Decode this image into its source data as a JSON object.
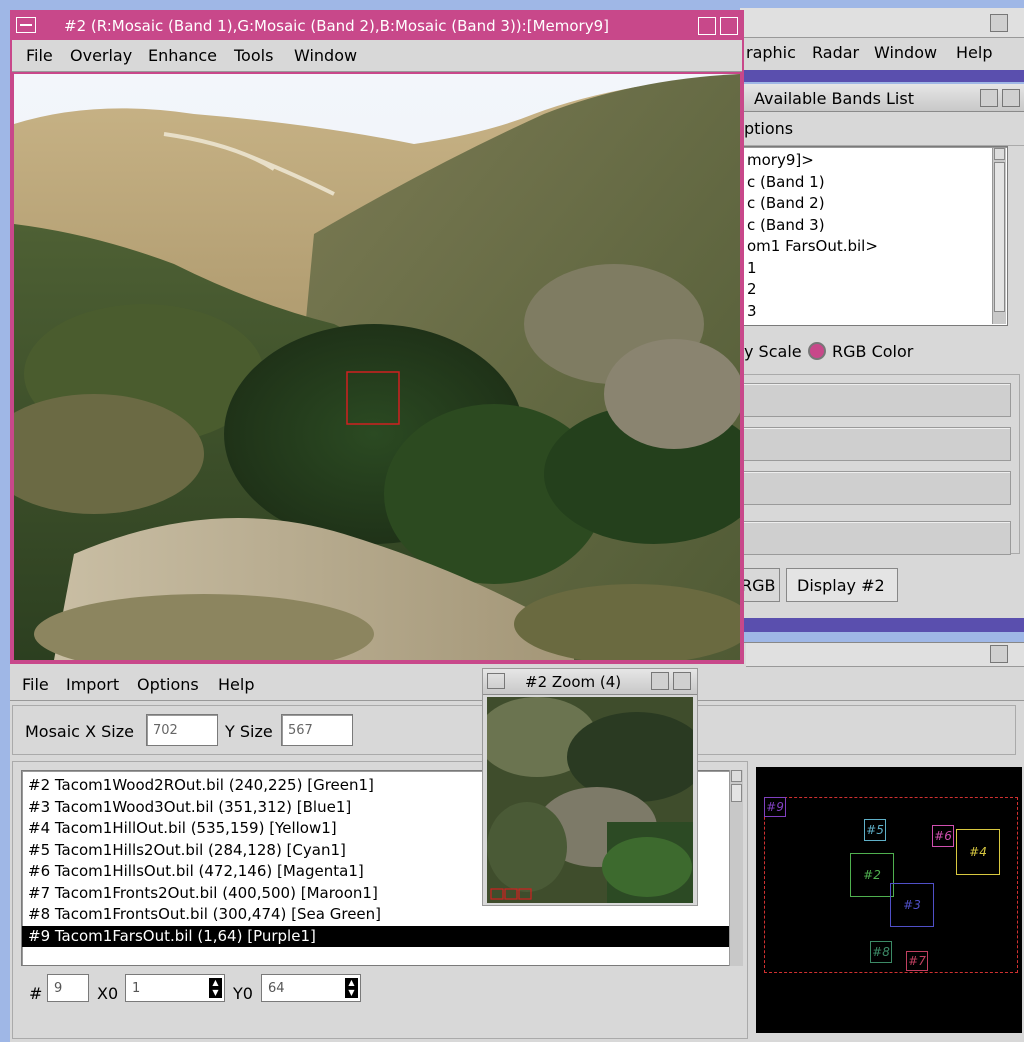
{
  "viewer": {
    "title": "#2 (R:Mosaic (Band 1),G:Mosaic (Band 2),B:Mosaic (Band 3)):[Memory9]",
    "menu": [
      "File",
      "Overlay",
      "Enhance",
      "Tools",
      "Window"
    ]
  },
  "main_menu": [
    "raphic",
    "Radar",
    "Window",
    "Help"
  ],
  "bands": {
    "title": "Available Bands List",
    "menu": "ptions",
    "items": [
      "mory9]>",
      "c (Band 1)",
      "c (Band 2)",
      "c (Band 3)",
      "om1 FarsOut.bil>",
      "1",
      "2",
      "3"
    ],
    "scale_label": "y Scale",
    "rgb_label": "RGB Color",
    "rgb_button": "RGB",
    "display_button": "Display #2"
  },
  "mosaic": {
    "menu": [
      "File",
      "Import",
      "Options",
      "Help"
    ],
    "x_size_label": "Mosaic X Size",
    "x_size": "702",
    "y_size_label": "Y Size",
    "y_size": "567",
    "files": [
      "#2 Tacom1Wood2ROut.bil (240,225) [Green1]",
      "#3 Tacom1Wood3Out.bil (351,312) [Blue1]",
      "#4 Tacom1HillOut.bil (535,159) [Yellow1]",
      "#5 Tacom1Hills2Out.bil (284,128) [Cyan1]",
      "#6 Tacom1HillsOut.bil (472,146) [Magenta1]",
      "#7 Tacom1Fronts2Out.bil (400,500) [Maroon1]",
      "#8 Tacom1FrontsOut.bil (300,474) [Sea Green]",
      "#9 Tacom1FarsOut.bil (1,64) [Purple1]"
    ],
    "selected_index": 7,
    "num_label": "#",
    "num_value": "9",
    "x0_label": "X0",
    "x0_value": "1",
    "y0_label": "Y0",
    "y0_value": "64",
    "preview_labels": [
      "#9",
      "#5",
      "#6",
      "#4",
      "#2",
      "#3",
      "#8",
      "#7"
    ]
  },
  "zoom": {
    "title": "#2 Zoom (4)"
  },
  "colors": {
    "pink": "#c8488a",
    "purple_bar": "#5a4fae",
    "green": "#4fb04f",
    "blue": "#5050c8",
    "yellow": "#d8c840",
    "cyan": "#5fb0c8",
    "magenta": "#d050b0",
    "maroon": "#c04060",
    "seagreen": "#3c8a66",
    "purple": "#8040c0"
  }
}
